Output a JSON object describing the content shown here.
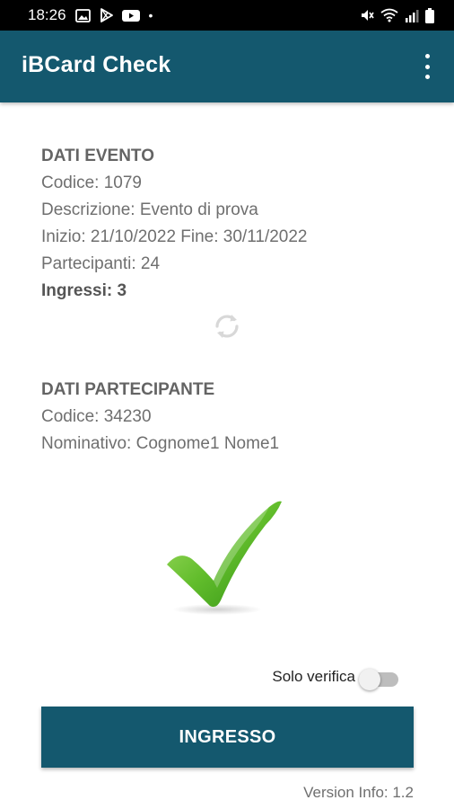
{
  "status_bar": {
    "time": "18:26",
    "dot": "•",
    "icons": [
      "gallery-icon",
      "play-store-icon",
      "youtube-icon",
      "mute-icon",
      "wifi-icon",
      "signal-icon",
      "battery-icon"
    ]
  },
  "app_bar": {
    "title": "iBCard Check",
    "menu_icon": "more-vert-icon"
  },
  "event": {
    "heading": "DATI EVENTO",
    "codice": "Codice: 1079",
    "descrizione": "Descrizione: Evento di prova",
    "date_range": "Inizio: 21/10/2022 Fine: 30/11/2022",
    "partecipanti": "Partecipanti: 24",
    "ingressi": "Ingressi: 3"
  },
  "participant": {
    "heading": "DATI PARTECIPANTE",
    "codice": "Codice: 34230",
    "nominativo": "Nominativo: Cognome1 Nome1"
  },
  "status_icon": "green-checkmark-icon",
  "refresh_icon": "refresh-icon",
  "solo_verifica": {
    "label": "Solo verifica",
    "enabled": false
  },
  "ingresso_button": "INGRESSO",
  "version_info": "Version Info: 1.2",
  "colors": {
    "primary": "#14586e",
    "check_green": "#5cb82b",
    "text_gray": "#6f6f6f"
  }
}
